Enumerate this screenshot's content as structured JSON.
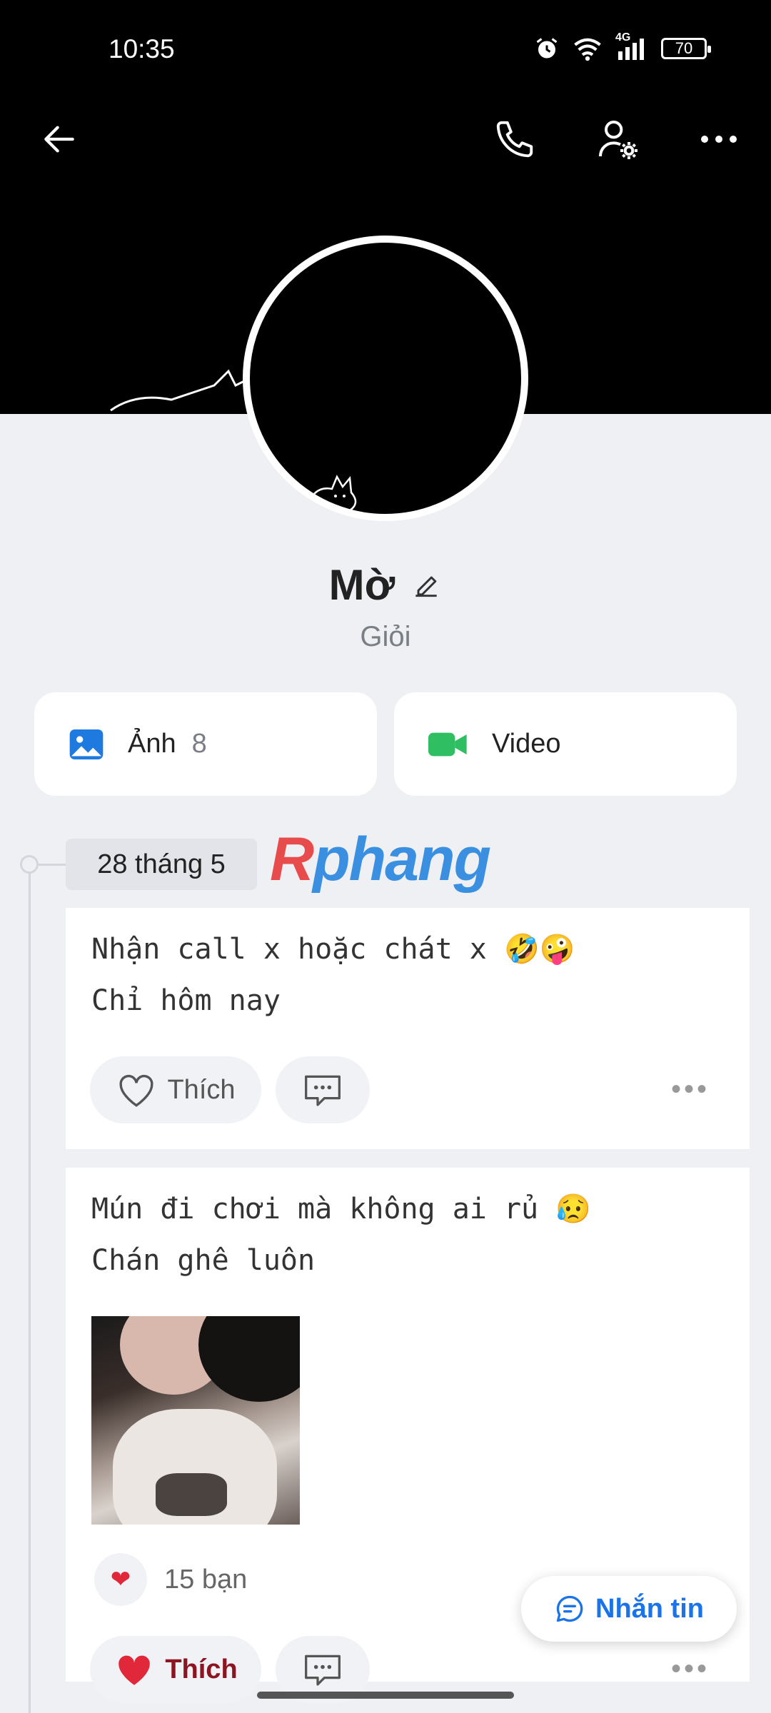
{
  "status_bar": {
    "time": "10:35",
    "network": "4G",
    "battery": "70"
  },
  "header": {
    "back_icon": "arrow-left-icon",
    "call_icon": "phone-icon",
    "settings_icon": "user-settings-icon",
    "more_icon": "more-horizontal-icon"
  },
  "profile": {
    "name": "Mờ",
    "bio": "Giỏi"
  },
  "media": {
    "photos_label": "Ảnh",
    "photos_count": "8",
    "video_label": "Video"
  },
  "timeline": {
    "date": "28 tháng 5"
  },
  "watermark": {
    "text": "Rphang"
  },
  "posts": [
    {
      "text": "Nhận call x hoặc chát x 🤣🤪\nChỉ hôm nay",
      "like_label": "Thích"
    },
    {
      "text": "Mún đi chơi mà không ai rủ 😥\nChán ghê luôn",
      "reactions": "15 bạn",
      "like_label": "Thích"
    }
  ],
  "fab": {
    "label": "Nhắn tin"
  },
  "colors": {
    "accent": "#1a73e8",
    "like_red": "#e0283a",
    "cover": "#000000",
    "background": "#eef0f4"
  }
}
